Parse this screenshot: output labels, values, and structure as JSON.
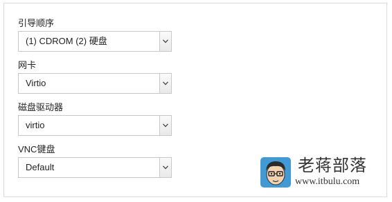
{
  "form": {
    "fields": [
      {
        "label": "引导顺序",
        "value": "(1) CDROM (2) 硬盘"
      },
      {
        "label": "网卡",
        "value": "Virtio"
      },
      {
        "label": "磁盘驱动器",
        "value": "virtio"
      },
      {
        "label": "VNC键盘",
        "value": "Default"
      }
    ]
  },
  "watermark": {
    "title": "老蒋部落",
    "url": "www.itbulu.com"
  }
}
